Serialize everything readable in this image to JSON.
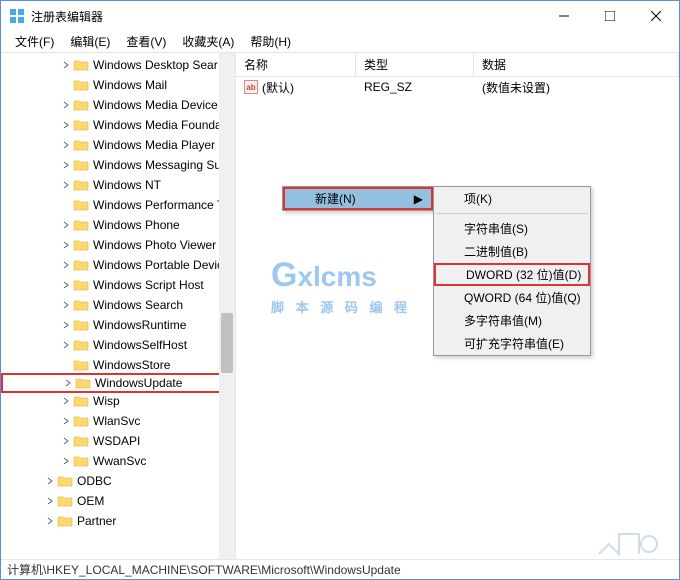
{
  "window": {
    "title": "注册表编辑器"
  },
  "menu": {
    "file": "文件(F)",
    "edit": "编辑(E)",
    "view": "查看(V)",
    "favorites": "收藏夹(A)",
    "help": "帮助(H)"
  },
  "tree": {
    "items": [
      {
        "label": "Windows Desktop Sear",
        "indent": 3,
        "expandable": true
      },
      {
        "label": "Windows Mail",
        "indent": 3,
        "expandable": false
      },
      {
        "label": "Windows Media Device",
        "indent": 3,
        "expandable": true
      },
      {
        "label": "Windows Media Founda",
        "indent": 3,
        "expandable": true
      },
      {
        "label": "Windows Media Player",
        "indent": 3,
        "expandable": true
      },
      {
        "label": "Windows Messaging Su",
        "indent": 3,
        "expandable": true
      },
      {
        "label": "Windows NT",
        "indent": 3,
        "expandable": true
      },
      {
        "label": "Windows Performance T",
        "indent": 3,
        "expandable": false
      },
      {
        "label": "Windows Phone",
        "indent": 3,
        "expandable": true
      },
      {
        "label": "Windows Photo Viewer",
        "indent": 3,
        "expandable": true
      },
      {
        "label": "Windows Portable Devic",
        "indent": 3,
        "expandable": true
      },
      {
        "label": "Windows Script Host",
        "indent": 3,
        "expandable": true
      },
      {
        "label": "Windows Search",
        "indent": 3,
        "expandable": true
      },
      {
        "label": "WindowsRuntime",
        "indent": 3,
        "expandable": true
      },
      {
        "label": "WindowsSelfHost",
        "indent": 3,
        "expandable": true
      },
      {
        "label": "WindowsStore",
        "indent": 3,
        "expandable": false
      },
      {
        "label": "WindowsUpdate",
        "indent": 3,
        "expandable": true,
        "highlighted": true
      },
      {
        "label": "Wisp",
        "indent": 3,
        "expandable": true
      },
      {
        "label": "WlanSvc",
        "indent": 3,
        "expandable": true
      },
      {
        "label": "WSDAPI",
        "indent": 3,
        "expandable": true
      },
      {
        "label": "WwanSvc",
        "indent": 3,
        "expandable": true
      },
      {
        "label": "ODBC",
        "indent": 2,
        "expandable": true
      },
      {
        "label": "OEM",
        "indent": 2,
        "expandable": true
      },
      {
        "label": "Partner",
        "indent": 2,
        "expandable": true
      }
    ]
  },
  "list": {
    "columns": {
      "name": "名称",
      "type": "类型",
      "data": "数据"
    },
    "rows": [
      {
        "name": "(默认)",
        "type": "REG_SZ",
        "data": "(数值未设置)"
      }
    ]
  },
  "context1": {
    "new": "新建(N)"
  },
  "context2": {
    "key": "项(K)",
    "string": "字符串值(S)",
    "binary": "二进制值(B)",
    "dword": "DWORD (32 位)值(D)",
    "qword": "QWORD (64 位)值(Q)",
    "multi": "多字符串值(M)",
    "expand": "可扩充字符串值(E)"
  },
  "status": {
    "path": "计算机\\HKEY_LOCAL_MACHINE\\SOFTWARE\\Microsoft\\WindowsUpdate"
  },
  "watermark": {
    "main": "xlcms",
    "sub": "脚 本 源 码 编 程"
  }
}
